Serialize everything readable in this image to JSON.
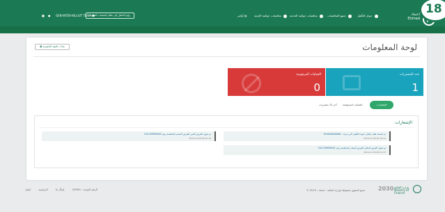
{
  "header": {
    "user_label": "GEN-INTER-KILLIUT TEAM",
    "switch_button_label": "وإنع الانتقال إلى نظام المنصات الشديد",
    "nav_items": [
      {
        "label": "ديوان التأهيل"
      },
      {
        "label": "جميع المنافسات"
      },
      {
        "label": "منافسات حوكمة الخدمة"
      },
      {
        "label": "منافسات حوكمة الإنجبة"
      },
      {
        "label": "أوامر"
      }
    ],
    "logo_text": "اعتماد Etimad",
    "badge_number": "18"
  },
  "page": {
    "title": "لوحة المعلومات",
    "top_left_button": "بيانات الجهة الحكومية"
  },
  "tiles": [
    {
      "label": "عدد المشتريات",
      "value": "1",
      "color": "#1aa3bc"
    },
    {
      "label": "العمليات المرفوضة",
      "value": "0",
      "color": "#d83a3a"
    }
  ],
  "tabs": [
    {
      "label": "الإشعارات",
      "active": true
    },
    {
      "label": "العمليات المرفوضة"
    },
    {
      "label": "آخر 10 مشتريات"
    }
  ],
  "announcements": {
    "title": "الإشعارات",
    "items": [
      {
        "text": "تم اعتماد طلب إعلان دعوة التأهيل لأمر شراء - 191600000006",
        "date": "2019-12-06 09:18:12"
      },
      {
        "text": "تم قبول العرض الفني للعرض المقدم للمنافسة رقم 191239999003",
        "date": "2019-12-06 08:22:18"
      },
      {
        "text": "تم قبول العرض المالي للعرض المقدم للمنافسة رقم 191239999003",
        "date": "2019-12-06 08:21:33"
      }
    ]
  },
  "footer": {
    "links": [
      "اتصل",
      "الرئيسية",
      "إسأل ما",
      "الرقم الموحد : 19990"
    ],
    "copyright": "© جميع الحقوق محفوظة لوزارة المالية - اعتماد - 2019",
    "vision": "2030",
    "ministry": "وزارة المالية Ministry of Finance"
  }
}
